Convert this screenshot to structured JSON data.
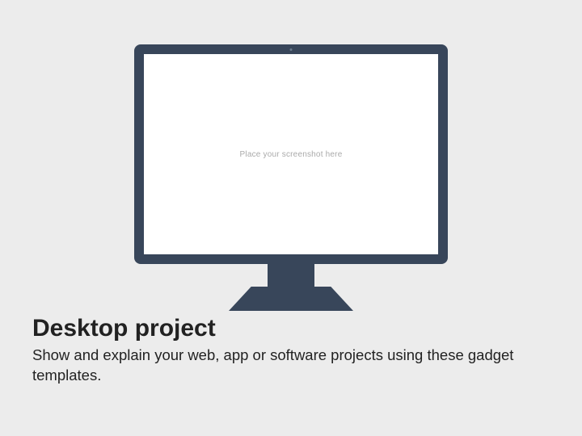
{
  "monitor": {
    "placeholder": "Place your screenshot here"
  },
  "heading": "Desktop project",
  "body": "Show and explain your web, app or software projects using these gadget templates."
}
